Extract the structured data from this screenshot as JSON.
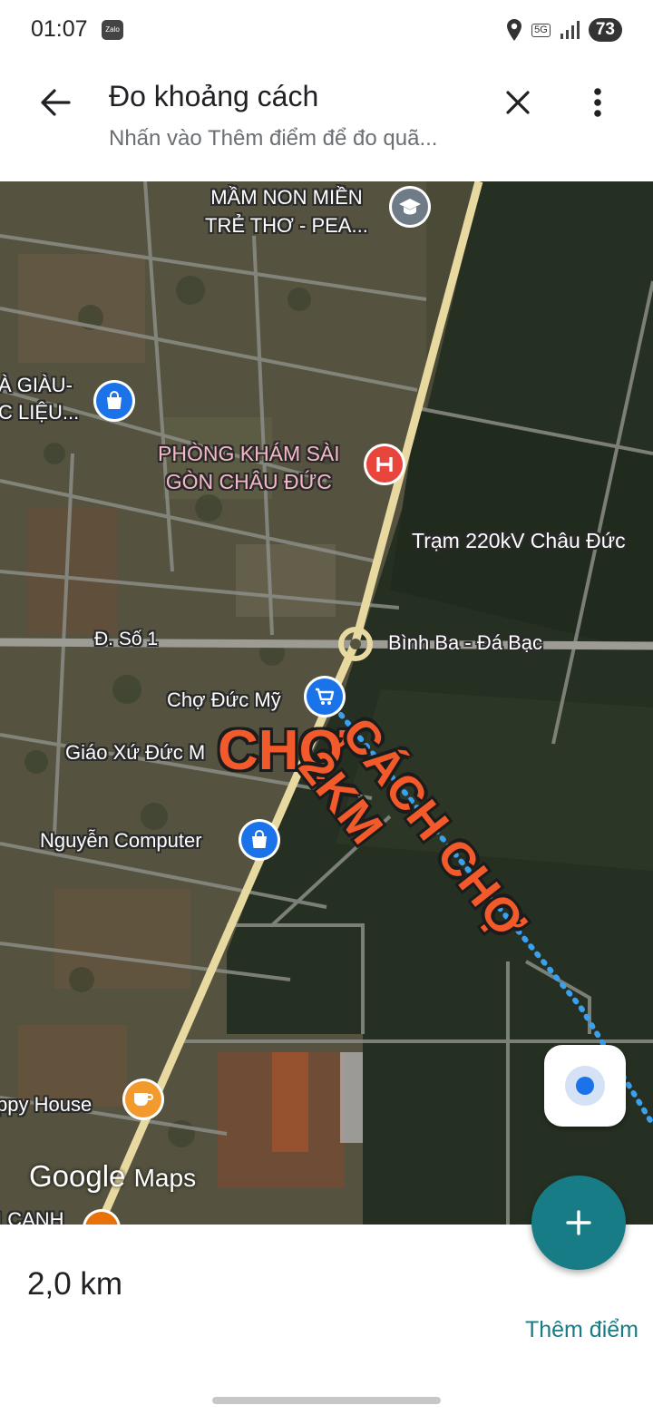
{
  "status_bar": {
    "time": "01:07",
    "app_icon_text": "Zalo",
    "network": "5G",
    "battery": "73"
  },
  "header": {
    "title": "Đo khoảng cách",
    "subtitle": "Nhấn vào Thêm điểm để đo quã..."
  },
  "map": {
    "places": {
      "kindergarten": [
        "MẦM NON MIỀN",
        "TRẺ THƠ - PEA..."
      ],
      "store_left": [
        "À GIÀU-",
        "C LIỆU..."
      ],
      "clinic": [
        "PHÒNG KHÁM SÀI",
        "GÒN CHÂU ĐỨC"
      ],
      "substation": "Trạm 220kV Châu Đức",
      "road_left": "Đ. Số 1",
      "road_right": "Bình Ba - Đá Bạc",
      "market": "Chợ Đức Mỹ",
      "church": "Giáo Xứ Đức M",
      "computer_shop": "Nguyễn Computer",
      "cafe": "ppy House",
      "bottom_cut": "I CANH"
    },
    "annotations": {
      "market_handwritten": "CHỢ",
      "distance_handwritten": "CÁCH CHỢ 2KM"
    },
    "logo": {
      "google": "Google",
      "maps": "Maps"
    },
    "icons": {
      "kindergarten": "graduation-cap-icon",
      "store": "shopping-bag-icon",
      "clinic": "hospital-icon",
      "market": "shopping-cart-icon",
      "cafe": "coffee-cup-icon"
    },
    "colors": {
      "measure_line": "#3aa0f0",
      "annotation": "#f25a2b",
      "main_road": "#e8d9a0"
    }
  },
  "measure": {
    "distance": "2,0 km",
    "add_point_label": "Thêm điểm"
  },
  "theme": {
    "accent": "#177c85",
    "poi_blue": "#1a73e8",
    "poi_red": "#e8453c"
  }
}
